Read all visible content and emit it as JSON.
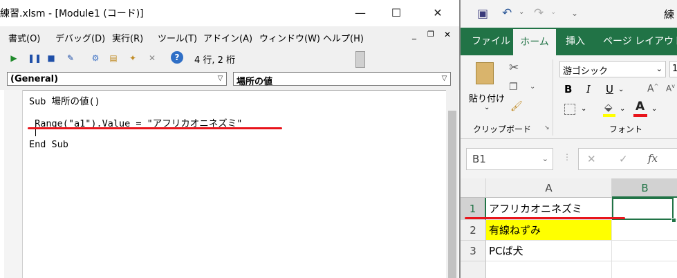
{
  "vbe": {
    "title": "練習.xlsm - [Module1 (コード)]",
    "menu": [
      "書式(O)",
      "デバッグ(D)",
      "実行(R)",
      "ツール(T)",
      "アドイン(A)",
      "ウィンドウ(W)",
      "ヘルプ(H)"
    ],
    "position": "4 行, 2 桁",
    "object_combo": "(General)",
    "proc_combo": "場所の値",
    "code": [
      "Sub 場所の値()",
      " Range(\"a1\").Value = \"アフリカオニネズミ\"",
      "End Sub"
    ]
  },
  "excel": {
    "title_fragment": "練",
    "tabs": [
      "ファイル",
      "ホーム",
      "挿入",
      "ページ レイアウト"
    ],
    "font_name": "游ゴシック",
    "font_size": "1",
    "paste_label": "貼り付け",
    "group_clipboard": "クリップボード",
    "group_font": "フォント",
    "bold": "B",
    "italic": "I",
    "underline": "U",
    "name_box": "B1",
    "fx": "fx",
    "columns": [
      "A",
      "B"
    ],
    "rows": [
      {
        "num": "1",
        "a": "アフリカオニネズミ",
        "b": ""
      },
      {
        "num": "2",
        "a": "有線ねずみ",
        "b": ""
      },
      {
        "num": "3",
        "a": "PCば犬",
        "b": ""
      }
    ],
    "highlight_color": "#ffff00",
    "accent_color": "#217346"
  },
  "annotation_color": "#e8141b"
}
